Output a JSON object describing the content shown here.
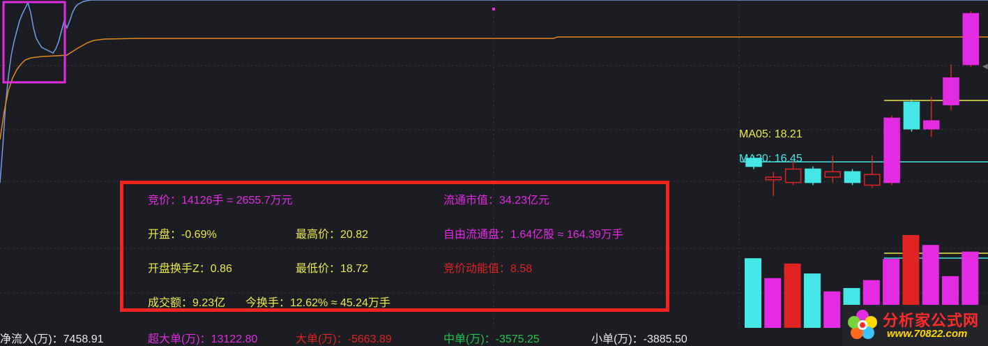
{
  "colors": {
    "background": "#1c1d22",
    "price_line": "#6f9fe6",
    "avg_line": "#e08a1e",
    "highlight_box": "#e32be3",
    "info_border": "#f2261f",
    "up": "#e32be3",
    "down": "#45e6e6",
    "red": "#e02323"
  },
  "ma": {
    "ma05": "MA05: 18.21",
    "ma20": "MA20: 16.45"
  },
  "info": {
    "auction": "竞价：14126手 = 2655.7万元",
    "float_cap": "流通市值：34.23亿元",
    "open": "开盘：-0.69%",
    "high": "最高价：20.82",
    "free_float": "自由流通盘：1.64亿股 ≈ 164.39万手",
    "open_turnover": "开盘换手Z：0.86",
    "low": "最低价：18.72",
    "auction_momentum": "竞价动能值：8.58",
    "amount": "成交额：9.23亿",
    "turnover": "今换手：12.62% ≈ 45.24万手"
  },
  "flows": {
    "net_inflow": "净流入(万)：7458.91",
    "super_large": "超大单(万)：13122.80",
    "large": "大单(万)：-5663.89",
    "medium": "中单(万)：-3575.25",
    "small": "小单(万)：-3885.50"
  },
  "logo": {
    "name": "分析家公式网",
    "url": "www.70822.com"
  },
  "candles": [
    {
      "dir": "down",
      "open": 16.9,
      "close": 16.6,
      "high": 17.0,
      "low": 16.5
    },
    {
      "dir": "up",
      "open": 16.1,
      "close": 16.2,
      "high": 16.4,
      "low": 15.5
    },
    {
      "dir": "up",
      "open": 16.0,
      "close": 16.5,
      "high": 16.8,
      "low": 15.9
    },
    {
      "dir": "down",
      "open": 16.5,
      "close": 16.0,
      "high": 16.6,
      "low": 15.9
    },
    {
      "dir": "up",
      "open": 16.2,
      "close": 16.4,
      "high": 17.0,
      "low": 16.0
    },
    {
      "dir": "down",
      "open": 16.4,
      "close": 16.0,
      "high": 16.5,
      "low": 15.9
    },
    {
      "dir": "up",
      "open": 15.9,
      "close": 16.3,
      "high": 17.0,
      "low": 15.8
    },
    {
      "dir": "up",
      "open": 16.0,
      "close": 18.4,
      "high": 18.5,
      "low": 15.9
    },
    {
      "dir": "down",
      "open": 19.0,
      "close": 18.0,
      "high": 19.1,
      "low": 17.9
    },
    {
      "dir": "up",
      "open": 18.0,
      "close": 18.3,
      "high": 19.2,
      "low": 17.7
    },
    {
      "dir": "up",
      "open": 18.9,
      "close": 19.9,
      "high": 20.4,
      "low": 18.7
    },
    {
      "dir": "up",
      "open": 20.4,
      "close": 22.3,
      "high": 22.4,
      "low": 20.3
    }
  ],
  "volumes": [
    {
      "dir": "down",
      "value": 1.05
    },
    {
      "dir": "up",
      "value": 0.75
    },
    {
      "dir": "up",
      "value": 0.97
    },
    {
      "dir": "down",
      "value": 0.82
    },
    {
      "dir": "up",
      "value": 0.55
    },
    {
      "dir": "down",
      "value": 0.6
    },
    {
      "dir": "up",
      "value": 0.72
    },
    {
      "dir": "up",
      "value": 1.04
    },
    {
      "dir": "down",
      "value": 1.4
    },
    {
      "dir": "up",
      "value": 1.25
    },
    {
      "dir": "up",
      "value": 0.78
    },
    {
      "dir": "up",
      "value": 1.15
    }
  ]
}
